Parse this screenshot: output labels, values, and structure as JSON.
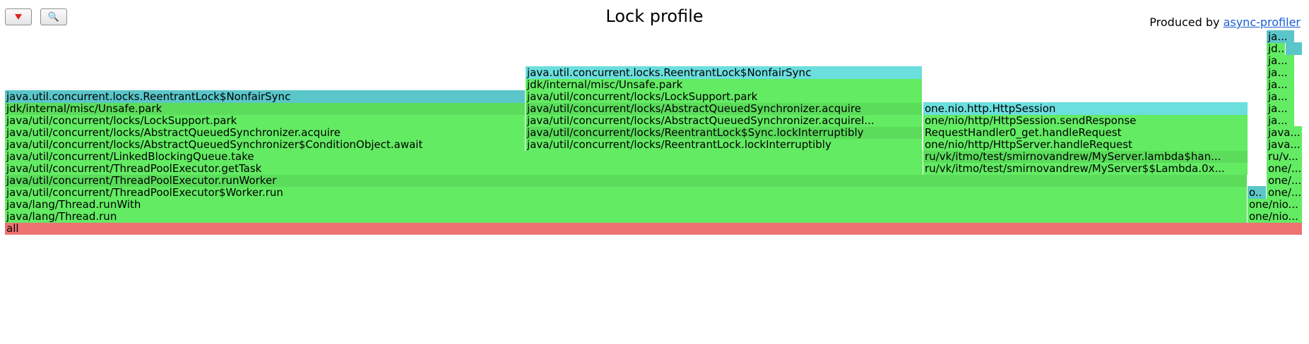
{
  "toolbar": {
    "reverse_button": {
      "icon": "red-down-triangle"
    },
    "search_button": {
      "icon": "magnifier-icon",
      "glyph": "🔍"
    }
  },
  "header": {
    "title": "Lock profile",
    "credit_prefix": "Produced by",
    "credit_link": "async-profiler"
  },
  "colors": {
    "java_green": "#63eb63",
    "java_green_dark": "#5bdc5b",
    "lock_class_aqua": "#5bc6c9",
    "lock_class_aqua_light": "#6bdede",
    "root_red": "#ee7272"
  },
  "flame": {
    "frames": [
      {
        "name": "all",
        "level": 0,
        "start": 0.0,
        "width": 1.0,
        "color": "#ee7272"
      },
      {
        "name": "java/lang/Thread.run",
        "level": 1,
        "start": 0.0,
        "width": 0.9577,
        "color": "#63eb63"
      },
      {
        "name": "one/nio...",
        "level": 1,
        "start": 0.9577,
        "width": 0.0423,
        "color": "#63eb63"
      },
      {
        "name": "java/lang/Thread.runWith",
        "level": 2,
        "start": 0.0,
        "width": 0.9577,
        "color": "#63eb63"
      },
      {
        "name": "one/nio...",
        "level": 2,
        "start": 0.9577,
        "width": 0.0423,
        "color": "#63eb63"
      },
      {
        "name": "java/util/concurrent/ThreadPoolExecutor$Worker.run",
        "level": 3,
        "start": 0.0,
        "width": 0.9577,
        "color": "#63eb63"
      },
      {
        "name": "o..",
        "level": 3,
        "start": 0.9577,
        "width": 0.0147,
        "color": "#5bc6c9"
      },
      {
        "name": "one/...",
        "level": 3,
        "start": 0.9724,
        "width": 0.0276,
        "color": "#63eb63"
      },
      {
        "name": "java/util/concurrent/ThreadPoolExecutor.runWorker",
        "level": 4,
        "start": 0.0,
        "width": 0.9577,
        "color": "#5bdc5b"
      },
      {
        "name": "one/...",
        "level": 4,
        "start": 0.9724,
        "width": 0.0276,
        "color": "#63eb63"
      },
      {
        "name": "java/util/concurrent/ThreadPoolExecutor.getTask",
        "level": 5,
        "start": 0.0,
        "width": 0.7075,
        "color": "#63eb63"
      },
      {
        "name": "ru/vk/itmo/test/smirnovandrew/MyServer$$Lambda.0x...",
        "level": 5,
        "start": 0.7075,
        "width": 0.2502,
        "color": "#63eb63"
      },
      {
        "name": "one/...",
        "level": 5,
        "start": 0.9724,
        "width": 0.0276,
        "color": "#63eb63"
      },
      {
        "name": "java/util/concurrent/LinkedBlockingQueue.take",
        "level": 6,
        "start": 0.0,
        "width": 0.7075,
        "color": "#63eb63"
      },
      {
        "name": "ru/vk/itmo/test/smirnovandrew/MyServer.lambda$han...",
        "level": 6,
        "start": 0.7075,
        "width": 0.2502,
        "color": "#5bdc5b"
      },
      {
        "name": "ru/v...",
        "level": 6,
        "start": 0.9724,
        "width": 0.0276,
        "color": "#63eb63"
      },
      {
        "name": "java/util/concurrent/locks/AbstractQueuedSynchronizer$ConditionObject.await",
        "level": 7,
        "start": 0.0,
        "width": 0.4013,
        "color": "#63eb63"
      },
      {
        "name": "java/util/concurrent/locks/ReentrantLock.lockInterruptibly",
        "level": 7,
        "start": 0.4013,
        "width": 0.3062,
        "color": "#63eb63"
      },
      {
        "name": "one/nio/http/HttpServer.handleRequest",
        "level": 7,
        "start": 0.7075,
        "width": 0.2502,
        "color": "#63eb63"
      },
      {
        "name": "java...",
        "level": 7,
        "start": 0.9724,
        "width": 0.0276,
        "color": "#63eb63"
      },
      {
        "name": "java/util/concurrent/locks/AbstractQueuedSynchronizer.acquire",
        "level": 8,
        "start": 0.0,
        "width": 0.4013,
        "color": "#63eb63"
      },
      {
        "name": "java/util/concurrent/locks/ReentrantLock$Sync.lockInterruptibly",
        "level": 8,
        "start": 0.4013,
        "width": 0.3062,
        "color": "#5bdc5b"
      },
      {
        "name": "RequestHandler0_get.handleRequest",
        "level": 8,
        "start": 0.7075,
        "width": 0.2502,
        "color": "#63eb63"
      },
      {
        "name": "java...",
        "level": 8,
        "start": 0.9724,
        "width": 0.0276,
        "color": "#63eb63"
      },
      {
        "name": "java/util/concurrent/locks/LockSupport.park",
        "level": 9,
        "start": 0.0,
        "width": 0.4013,
        "color": "#63eb63"
      },
      {
        "name": "java/util/concurrent/locks/AbstractQueuedSynchronizer.acquireI...",
        "level": 9,
        "start": 0.4013,
        "width": 0.3062,
        "color": "#63eb63"
      },
      {
        "name": "one/nio/http/HttpSession.sendResponse",
        "level": 9,
        "start": 0.7075,
        "width": 0.2502,
        "color": "#63eb63"
      },
      {
        "name": "ja...",
        "level": 9,
        "start": 0.9724,
        "width": 0.0218,
        "color": "#63eb63"
      },
      {
        "name": "jdk/internal/misc/Unsafe.park",
        "level": 10,
        "start": 0.0,
        "width": 0.4013,
        "color": "#5bdc5b"
      },
      {
        "name": "java/util/concurrent/locks/AbstractQueuedSynchronizer.acquire",
        "level": 10,
        "start": 0.4013,
        "width": 0.3062,
        "color": "#5bdc5b"
      },
      {
        "name": "one.nio.http.HttpSession",
        "level": 10,
        "start": 0.7075,
        "width": 0.2502,
        "color": "#6bdede"
      },
      {
        "name": "ja...",
        "level": 10,
        "start": 0.9724,
        "width": 0.0218,
        "color": "#63eb63"
      },
      {
        "name": "java.util.concurrent.locks.ReentrantLock$NonfairSync",
        "level": 11,
        "start": 0.0,
        "width": 0.4013,
        "color": "#5bc6c9"
      },
      {
        "name": "java/util/concurrent/locks/LockSupport.park",
        "level": 11,
        "start": 0.4013,
        "width": 0.3062,
        "color": "#63eb63"
      },
      {
        "name": "ja...",
        "level": 11,
        "start": 0.9724,
        "width": 0.0218,
        "color": "#63eb63"
      },
      {
        "name": "jdk/internal/misc/Unsafe.park",
        "level": 12,
        "start": 0.4013,
        "width": 0.3062,
        "color": "#63eb63"
      },
      {
        "name": "ja...",
        "level": 12,
        "start": 0.9724,
        "width": 0.0218,
        "color": "#63eb63"
      },
      {
        "name": "java.util.concurrent.locks.ReentrantLock$NonfairSync",
        "level": 13,
        "start": 0.4013,
        "width": 0.3062,
        "color": "#6bdede"
      },
      {
        "name": "ja...",
        "level": 13,
        "start": 0.9724,
        "width": 0.0218,
        "color": "#63eb63"
      },
      {
        "name": "ja...",
        "level": 14,
        "start": 0.9724,
        "width": 0.0218,
        "color": "#63eb63"
      },
      {
        "name": "jd...",
        "level": 15,
        "start": 0.9724,
        "width": 0.0218,
        "color": "#63eb63"
      },
      {
        "name": "",
        "level": 15,
        "start": 0.9872,
        "width": 0.0128,
        "color": "#5bc6c9"
      },
      {
        "name": "ja...",
        "level": 16,
        "start": 0.9724,
        "width": 0.0218,
        "color": "#5bc6c9"
      }
    ]
  }
}
